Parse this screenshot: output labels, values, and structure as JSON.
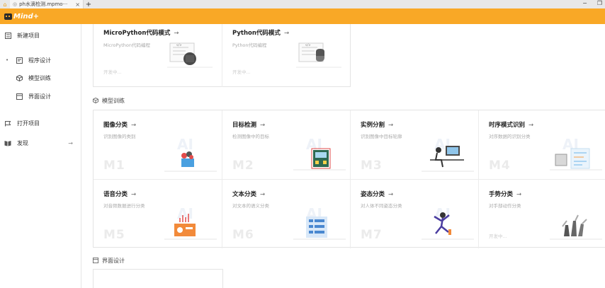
{
  "tabbar": {
    "tab_label": "ph水滴检测.mpmo···",
    "close": "×",
    "new_tab": "+",
    "minimize": "−",
    "restore": "❐"
  },
  "app": {
    "logo_text": "Mind+"
  },
  "sidebar": {
    "items": [
      {
        "label": "新建项目",
        "icon": "new-project-icon"
      },
      {
        "label": "程序设计",
        "icon": "code-icon"
      },
      {
        "label": "模型训练",
        "icon": "cube-icon"
      },
      {
        "label": "界面设计",
        "icon": "window-icon"
      },
      {
        "label": "打开项目",
        "icon": "folder-icon"
      },
      {
        "label": "发现",
        "icon": "book-icon",
        "arrow": "→"
      }
    ]
  },
  "programming": {
    "cards": [
      {
        "title": "MicroPython代码模式",
        "desc": "MicroPython代码编程",
        "soon": "开发中..."
      },
      {
        "title": "Python代码模式",
        "desc": "Python代码编程",
        "soon": "开发中..."
      }
    ]
  },
  "model_training": {
    "section_title": "模型训练",
    "cards": [
      {
        "title": "图像分类",
        "desc": "识别图像的类别",
        "code": "M1",
        "ai": "AI"
      },
      {
        "title": "目标检测",
        "desc": "检测图像中的目标",
        "code": "M2",
        "ai": "AI"
      },
      {
        "title": "实例分割",
        "desc": "识别图像中目标轮廓",
        "code": "M3",
        "ai": "AI"
      },
      {
        "title": "时序模式识别",
        "desc": "对序数据的识别分类",
        "code": "M4",
        "ai": "AI"
      },
      {
        "title": "语音分类",
        "desc": "对音频数据进行分类",
        "code": "M5",
        "ai": "AI"
      },
      {
        "title": "文本分类",
        "desc": "对文本的语义分类",
        "code": "M6",
        "ai": "AI"
      },
      {
        "title": "姿态分类",
        "desc": "对人体不同姿态分类",
        "code": "M7",
        "ai": "AI"
      },
      {
        "title": "手势分类",
        "desc": "对手部动作分类",
        "soon": "开发中..."
      }
    ]
  },
  "ui_design": {
    "section_title": "界面设计"
  },
  "arrow": "→"
}
